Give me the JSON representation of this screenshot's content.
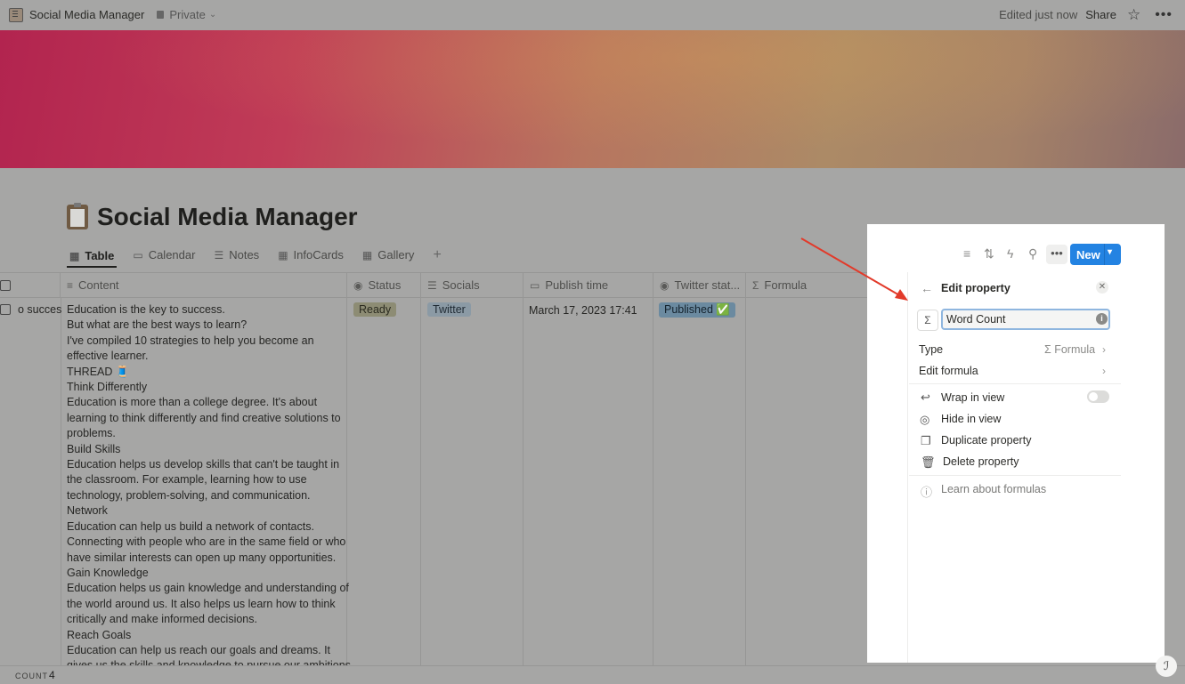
{
  "topbar": {
    "title": "Social Media Manager",
    "privacy": "Private",
    "edited": "Edited just now",
    "share": "Share",
    "star_icon": "star-icon",
    "more_icon": "more-icon"
  },
  "page": {
    "title": "Social Media Manager"
  },
  "tabs": [
    {
      "label": "Table",
      "icon": "table-icon",
      "active": true
    },
    {
      "label": "Calendar",
      "icon": "calendar-icon"
    },
    {
      "label": "Notes",
      "icon": "list-icon"
    },
    {
      "label": "InfoCards",
      "icon": "grid-icon"
    },
    {
      "label": "Gallery",
      "icon": "grid-icon"
    }
  ],
  "table": {
    "columns": [
      "Content",
      "Status",
      "Socials",
      "Publish time",
      "Twitter stat...",
      "Formula"
    ],
    "row": {
      "name_fragment": "o succes",
      "content_lines": [
        "Education is the key to success.",
        "But what are the best ways to learn?",
        "I've compiled 10 strategies to help you become an",
        "effective learner.",
        "THREAD 🧵",
        "Think Differently",
        "Education is more than a college degree. It's about",
        "learning to think differently and find creative solutions to",
        "problems.",
        "Build Skills",
        "Education helps us develop skills that can't be taught in",
        "the classroom. For example, learning how to use",
        "technology, problem-solving, and communication.",
        "Network",
        "Education can help us build a network of contacts.",
        "Connecting with people who are in the same field or who",
        "have similar interests can open up many opportunities.",
        "Gain Knowledge",
        "Education helps us gain knowledge and understanding of",
        "the world around us. It also helps us learn how to think",
        "critically and make informed decisions.",
        "Reach Goals",
        "Education can help us reach our goals and dreams. It",
        "gives us the skills and knowledge to pursue our ambitions"
      ],
      "status": "Ready",
      "socials": "Twitter",
      "publish_time": "March 17, 2023 17:41",
      "twitter_status": "Published ✅"
    }
  },
  "footer": {
    "count_label": "COUNT",
    "count_value": "4"
  },
  "panel": {
    "new_button": "New",
    "edit_property": {
      "title": "Edit property",
      "name_value": "Word Count",
      "type_label": "Type",
      "type_value": "Σ Formula",
      "edit_formula": "Edit formula",
      "wrap_in_view": "Wrap in view",
      "hide_in_view": "Hide in view",
      "duplicate": "Duplicate property",
      "delete": "Delete property",
      "learn": "Learn about formulas"
    }
  },
  "colors": {
    "accent": "#2383e2",
    "annotation_arrow": "#e23a2a"
  }
}
